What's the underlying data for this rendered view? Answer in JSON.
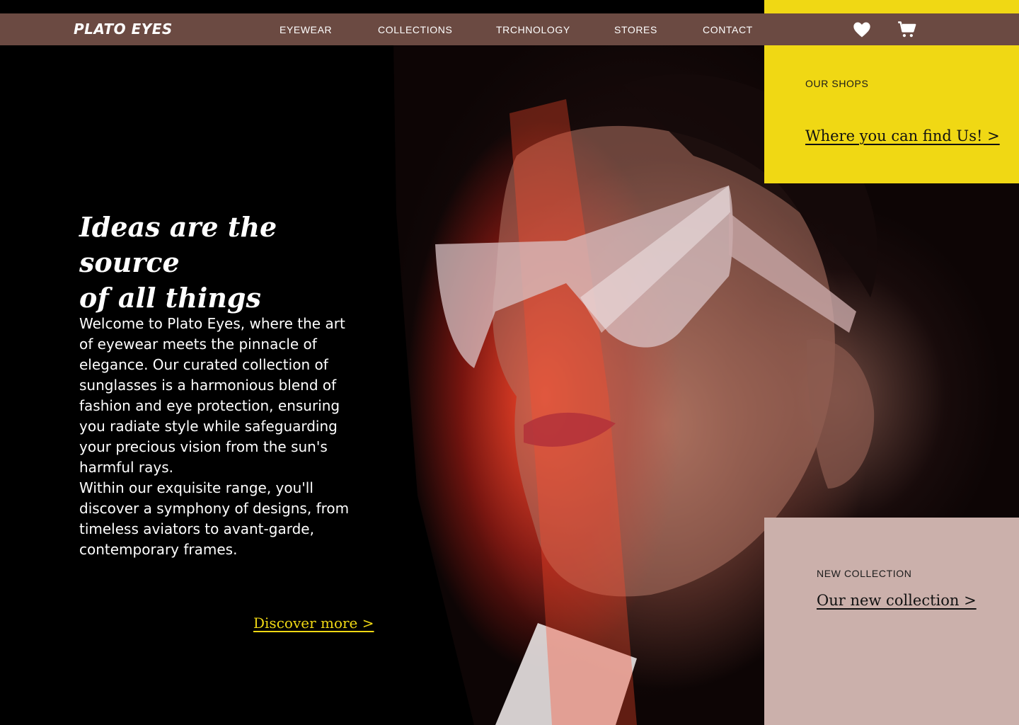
{
  "brand": {
    "logo": "PLATO EYES"
  },
  "nav": {
    "items": [
      {
        "label": "EYEWEAR"
      },
      {
        "label": "COLLECTIONS"
      },
      {
        "label": "TRCHNOLOGY"
      },
      {
        "label": "STORES"
      },
      {
        "label": "CONTACT"
      }
    ],
    "icons": [
      "heart-icon",
      "cart-icon"
    ]
  },
  "shops_card": {
    "eyebrow": "OUR SHOPS",
    "link": "Where you can find Us! >",
    "color": "#f0d814"
  },
  "collection_card": {
    "eyebrow": "NEW COLLECTION",
    "link": "Our new collection >",
    "color": "#cbb0ab"
  },
  "hero": {
    "headline": "Ideas are the source\n of all things",
    "body": "Welcome to Plato Eyes, where the art of eyewear meets the pinnacle of elegance. Our curated collection of sunglasses is a harmonious blend of fashion and eye protection, ensuring you radiate style while safeguarding your precious vision from the sun's harmful rays.\nWithin our exquisite range, you'll discover a symphony of designs, from timeless aviators to avant-garde, contemporary frames.",
    "cta": "Discover more >"
  },
  "colors": {
    "nav_background": "#6b4a42",
    "accent_yellow": "#f0d814",
    "accent_pink": "#cbb0ab",
    "background": "#000000"
  }
}
